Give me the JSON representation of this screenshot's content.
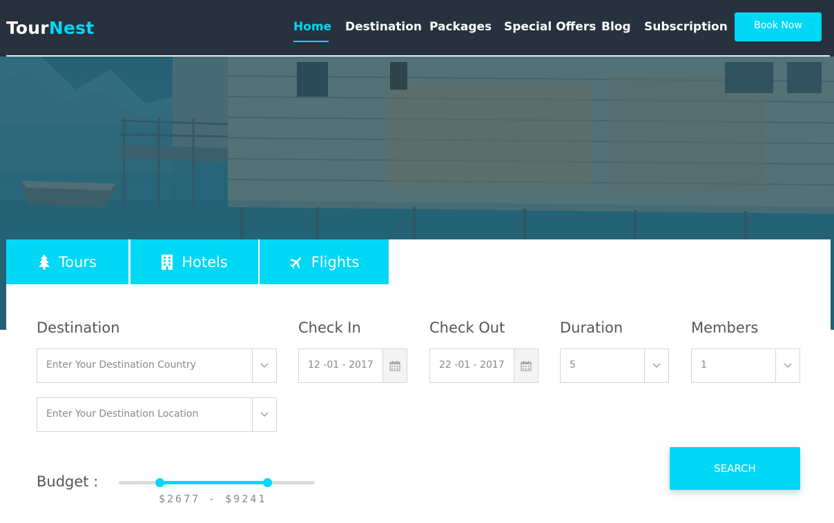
{
  "brand": {
    "part1": "Tour",
    "part2": "Nest"
  },
  "nav": {
    "items": [
      {
        "label": "Home"
      },
      {
        "label": "Destination"
      },
      {
        "label": "Packages"
      },
      {
        "label": "Special Offers"
      },
      {
        "label": "Blog"
      },
      {
        "label": "Subscription"
      }
    ],
    "active": "Home",
    "book_now": "Book Now"
  },
  "tabs": [
    {
      "label": "Tours",
      "icon": "tree-icon"
    },
    {
      "label": "Hotels",
      "icon": "building-icon"
    },
    {
      "label": "Flights",
      "icon": "plane-icon"
    }
  ],
  "form": {
    "destination": {
      "label": "Destination",
      "country_placeholder": "Enter Your Destination Country",
      "location_placeholder": "Enter Your Destination Location"
    },
    "check_in": {
      "label": "Check In",
      "value": "12 -01 - 2017"
    },
    "check_out": {
      "label": "Check Out",
      "value": "22 -01 - 2017"
    },
    "duration": {
      "label": "Duration",
      "value": "5"
    },
    "members": {
      "label": "Members",
      "value": "1"
    },
    "budget": {
      "label": "Budget :",
      "display": "$2677 - $9241",
      "min_value": 2677,
      "max_value": 9241,
      "range_low_fraction": 0.21,
      "range_high_fraction": 0.76
    },
    "search": "SEARCH"
  },
  "colors": {
    "accent": "#00d8f5",
    "header_bg": "#282e3a",
    "text": "#555555"
  }
}
